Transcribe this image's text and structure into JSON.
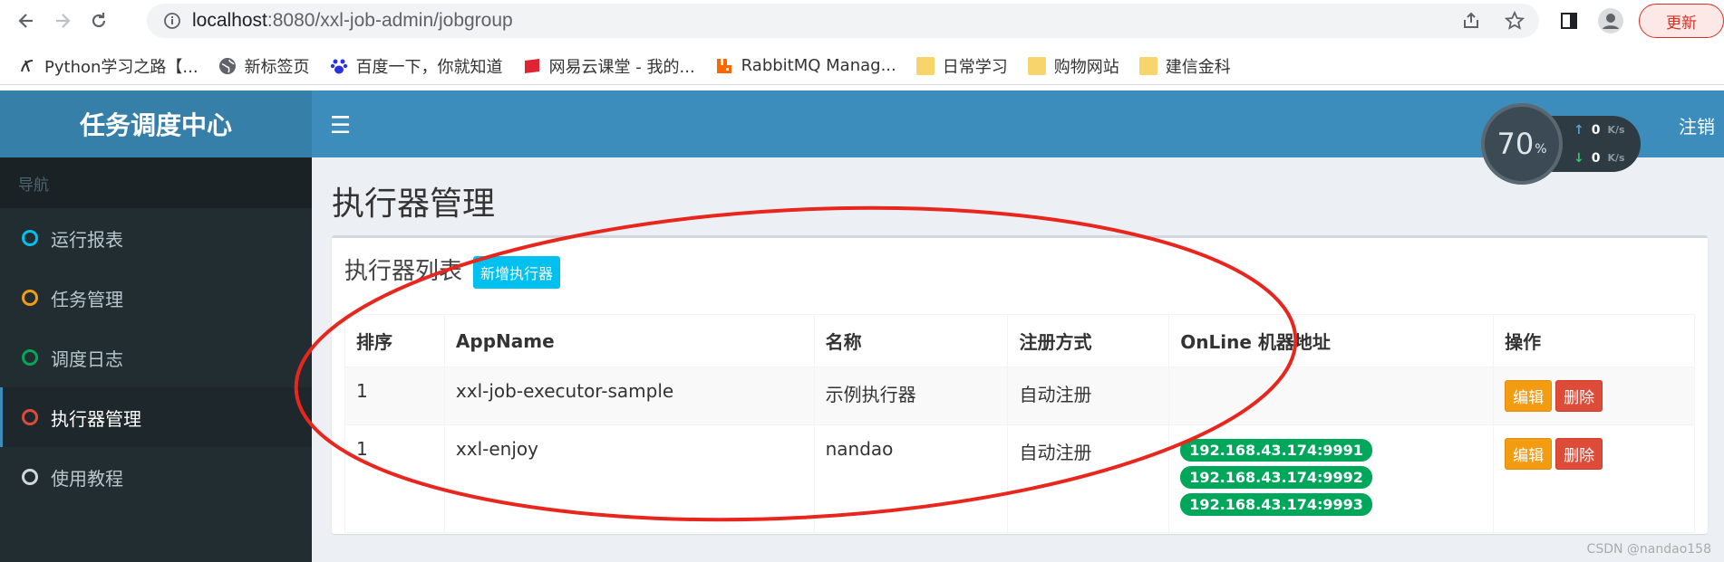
{
  "browser": {
    "url_host": "localhost",
    "url_path": ":8080/xxl-job-admin/jobgroup",
    "update_label": "更新",
    "bookmarks": [
      {
        "label": "Python学习之路【..."
      },
      {
        "label": "新标签页"
      },
      {
        "label": "百度一下，你就知道"
      },
      {
        "label": "网易云课堂 - 我的..."
      },
      {
        "label": "RabbitMQ Manag..."
      },
      {
        "label": "日常学习"
      },
      {
        "label": "购物网站"
      },
      {
        "label": "建信金科"
      }
    ]
  },
  "app": {
    "logo": "任务调度中心",
    "nav_header": "导航",
    "menu": [
      {
        "label": "运行报表",
        "color": "#00c0ef"
      },
      {
        "label": "任务管理",
        "color": "#f39c12"
      },
      {
        "label": "调度日志",
        "color": "#00a65a"
      },
      {
        "label": "执行器管理",
        "color": "#dd4b39"
      },
      {
        "label": "使用教程",
        "color": "#d2d6de"
      }
    ],
    "header_menu_icon": "☰",
    "logout_label": "注销",
    "page_title": "执行器管理",
    "box_title": "执行器列表",
    "add_button": "新增执行器",
    "columns": [
      "排序",
      "AppName",
      "名称",
      "注册方式",
      "OnLine 机器地址",
      "操作"
    ],
    "rows": [
      {
        "order": "1",
        "appname": "xxl-job-executor-sample",
        "name": "示例执行器",
        "reg": "自动注册",
        "addresses": []
      },
      {
        "order": "1",
        "appname": "xxl-enjoy",
        "name": "nandao",
        "reg": "自动注册",
        "addresses": [
          "192.168.43.174:9991",
          "192.168.43.174:9992",
          "192.168.43.174:9993"
        ]
      }
    ],
    "edit_label": "编辑",
    "delete_label": "删除"
  },
  "speed_widget": {
    "percent": "70",
    "percent_unit": "%",
    "up": "0",
    "down": "0",
    "unit": "K/s"
  },
  "watermark": "CSDN @nandao158"
}
